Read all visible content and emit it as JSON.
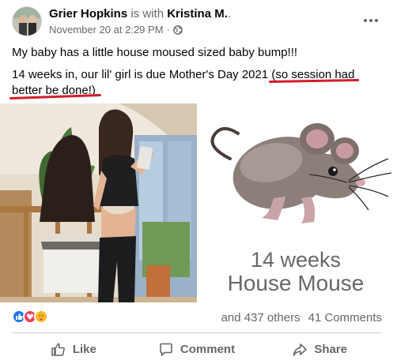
{
  "post": {
    "author": "Grier Hopkins",
    "with_text": " is with ",
    "tagged": "Kristina M.",
    "tagged_suffix": ".",
    "date": "November 20 at 2:29 PM",
    "separator": "·",
    "privacy_icon": "globe-icon",
    "line1": "My baby has a little house moused sized baby bump!!!",
    "line2_part1": "14 weeks in, our lil' girl is due Mother's Day 2021 ",
    "line2_highlight1": "(so session had",
    "line3_highlight2": "better be done!)"
  },
  "image_right": {
    "caption_line1": "14 weeks",
    "caption_line2": "House Mouse"
  },
  "engagement": {
    "reactions": [
      "like-reaction-icon",
      "love-reaction-icon",
      "care-reaction-icon"
    ],
    "others": "and 437 others",
    "comments": "41 Comments"
  },
  "actions": {
    "like": "Like",
    "comment": "Comment",
    "share": "Share"
  },
  "colors": {
    "annotation_red": "#d41e2a",
    "secondary_text": "#65676b",
    "like_blue": "#1877f2",
    "love_red": "#f33e58"
  }
}
